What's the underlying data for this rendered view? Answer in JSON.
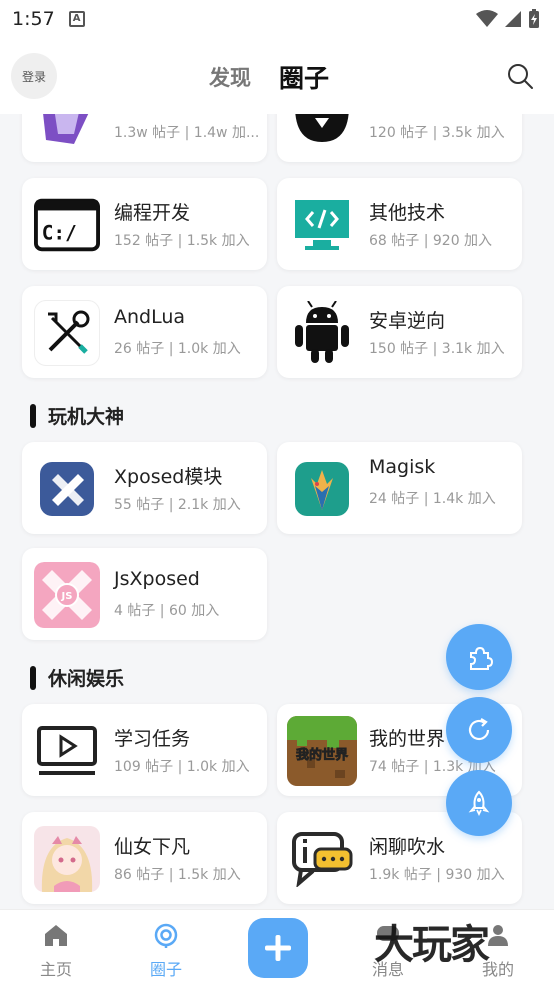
{
  "status_bar": {
    "time": "1:57"
  },
  "header": {
    "login_label": "登录",
    "tab_discover": "发现",
    "tab_circle": "圈子"
  },
  "sections": {
    "play_gods": "玩机大神",
    "leisure": "休闲娱乐"
  },
  "cards": {
    "top_left": {
      "stats": "1.3w 帖子 | 1.4w 加..."
    },
    "top_right": {
      "stats": "120 帖子 | 3.5k 加入"
    },
    "programming": {
      "name": "编程开发",
      "stats": "152 帖子 | 1.5k 加入"
    },
    "other_tech": {
      "name": "其他技术",
      "stats": "68 帖子 | 920 加入"
    },
    "andlua": {
      "name": "AndLua",
      "stats": "26 帖子 | 1.0k 加入"
    },
    "android_reverse": {
      "name": "安卓逆向",
      "stats": "150 帖子 | 3.1k 加入"
    },
    "xposed": {
      "name": "Xposed模块",
      "stats": "55 帖子 | 2.1k 加入"
    },
    "magisk": {
      "name": "Magisk",
      "stats": "24 帖子 | 1.4k 加入"
    },
    "jsxposed": {
      "name": "JsXposed",
      "stats": "4 帖子 | 60 加入",
      "logo_text": "JS"
    },
    "study_task": {
      "name": "学习任务",
      "stats": "109 帖子 | 1.0k 加入"
    },
    "minecraft": {
      "name": "我的世界",
      "stats": "74 帖子 | 1.3k 加入",
      "logo_text": "我的世界"
    },
    "fairy": {
      "name": "仙女下凡",
      "stats": "86 帖子 | 1.5k 加入"
    },
    "chat": {
      "name": "闲聊吹水",
      "stats": "1.9k 帖子 | 930 加入"
    }
  },
  "bottom_nav": {
    "home": "主页",
    "circle": "圈子",
    "messages": "消息",
    "mine": "我的"
  },
  "watermark": "大玩家",
  "colors": {
    "accent": "#5aa9f6",
    "text": "#222222",
    "muted": "#999999"
  }
}
